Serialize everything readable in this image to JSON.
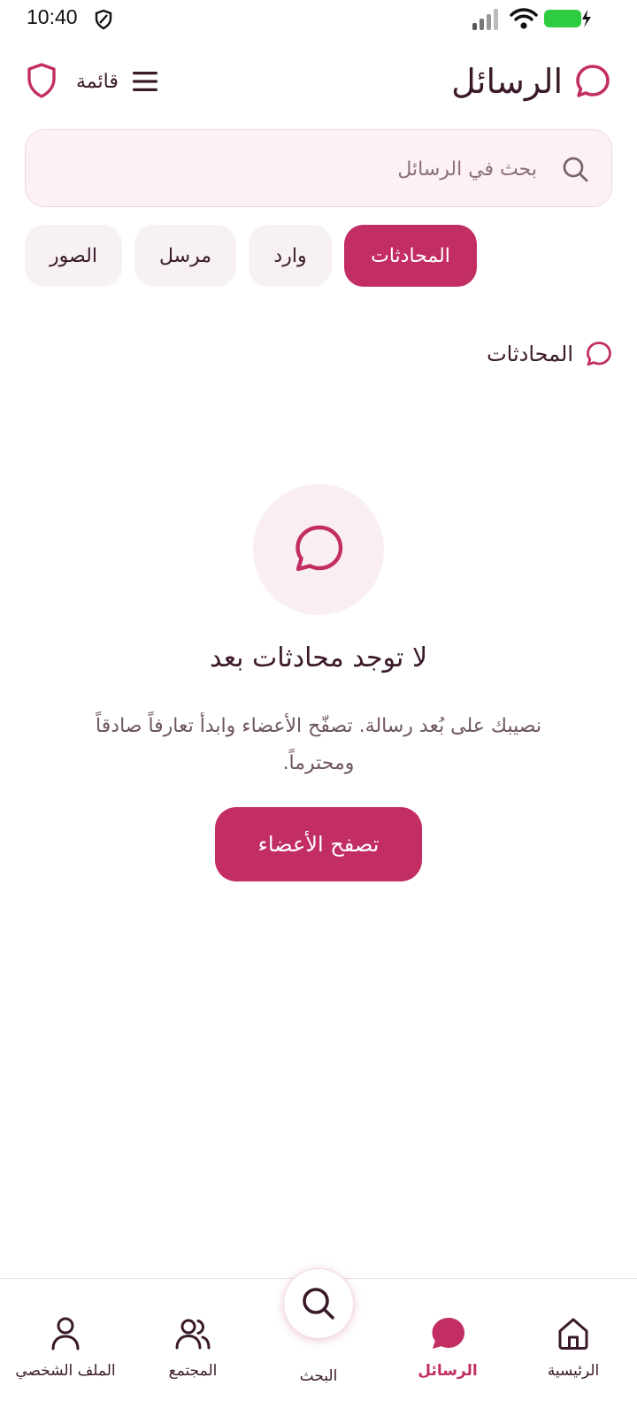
{
  "status_bar": {
    "time": "10:40",
    "icons": [
      "vpn-shield-icon",
      "signal-icon",
      "wifi-icon",
      "battery-charging-icon"
    ],
    "battery_color": "#2ecc40"
  },
  "header": {
    "title": "الرسائل",
    "menu_label": "قائمة",
    "title_icon": "chat-bubble-icon",
    "shield_icon": "shield-icon"
  },
  "search": {
    "placeholder": "بحث في الرسائل",
    "value": ""
  },
  "tabs": [
    {
      "label": "المحادثات",
      "active": true
    },
    {
      "label": "وارد",
      "active": false
    },
    {
      "label": "مرسل",
      "active": false
    },
    {
      "label": "الصور",
      "active": false
    }
  ],
  "section": {
    "title": "المحادثات"
  },
  "empty_state": {
    "title": "لا توجد محادثات بعد",
    "description": "نصيبك على بُعد رسالة. تصفّح الأعضاء وابدأ تعارفاً صادقاً ومحترماً.",
    "button_label": "تصفح الأعضاء"
  },
  "bottom_nav": {
    "items": [
      {
        "label": "الرئيسية",
        "icon": "home-icon",
        "active": false
      },
      {
        "label": "الرسائل",
        "icon": "chat-bubble-icon",
        "active": true
      },
      {
        "label": "البحث",
        "icon": "search-icon",
        "active": false
      },
      {
        "label": "المجتمع",
        "icon": "users-icon",
        "active": false
      },
      {
        "label": "الملف الشخصي",
        "icon": "user-icon",
        "active": false
      }
    ]
  },
  "colors": {
    "accent": "#c22e63",
    "text_dark": "#3a1a2a",
    "search_bg": "#fcf1f4",
    "tab_bg": "#f7f1f3"
  }
}
